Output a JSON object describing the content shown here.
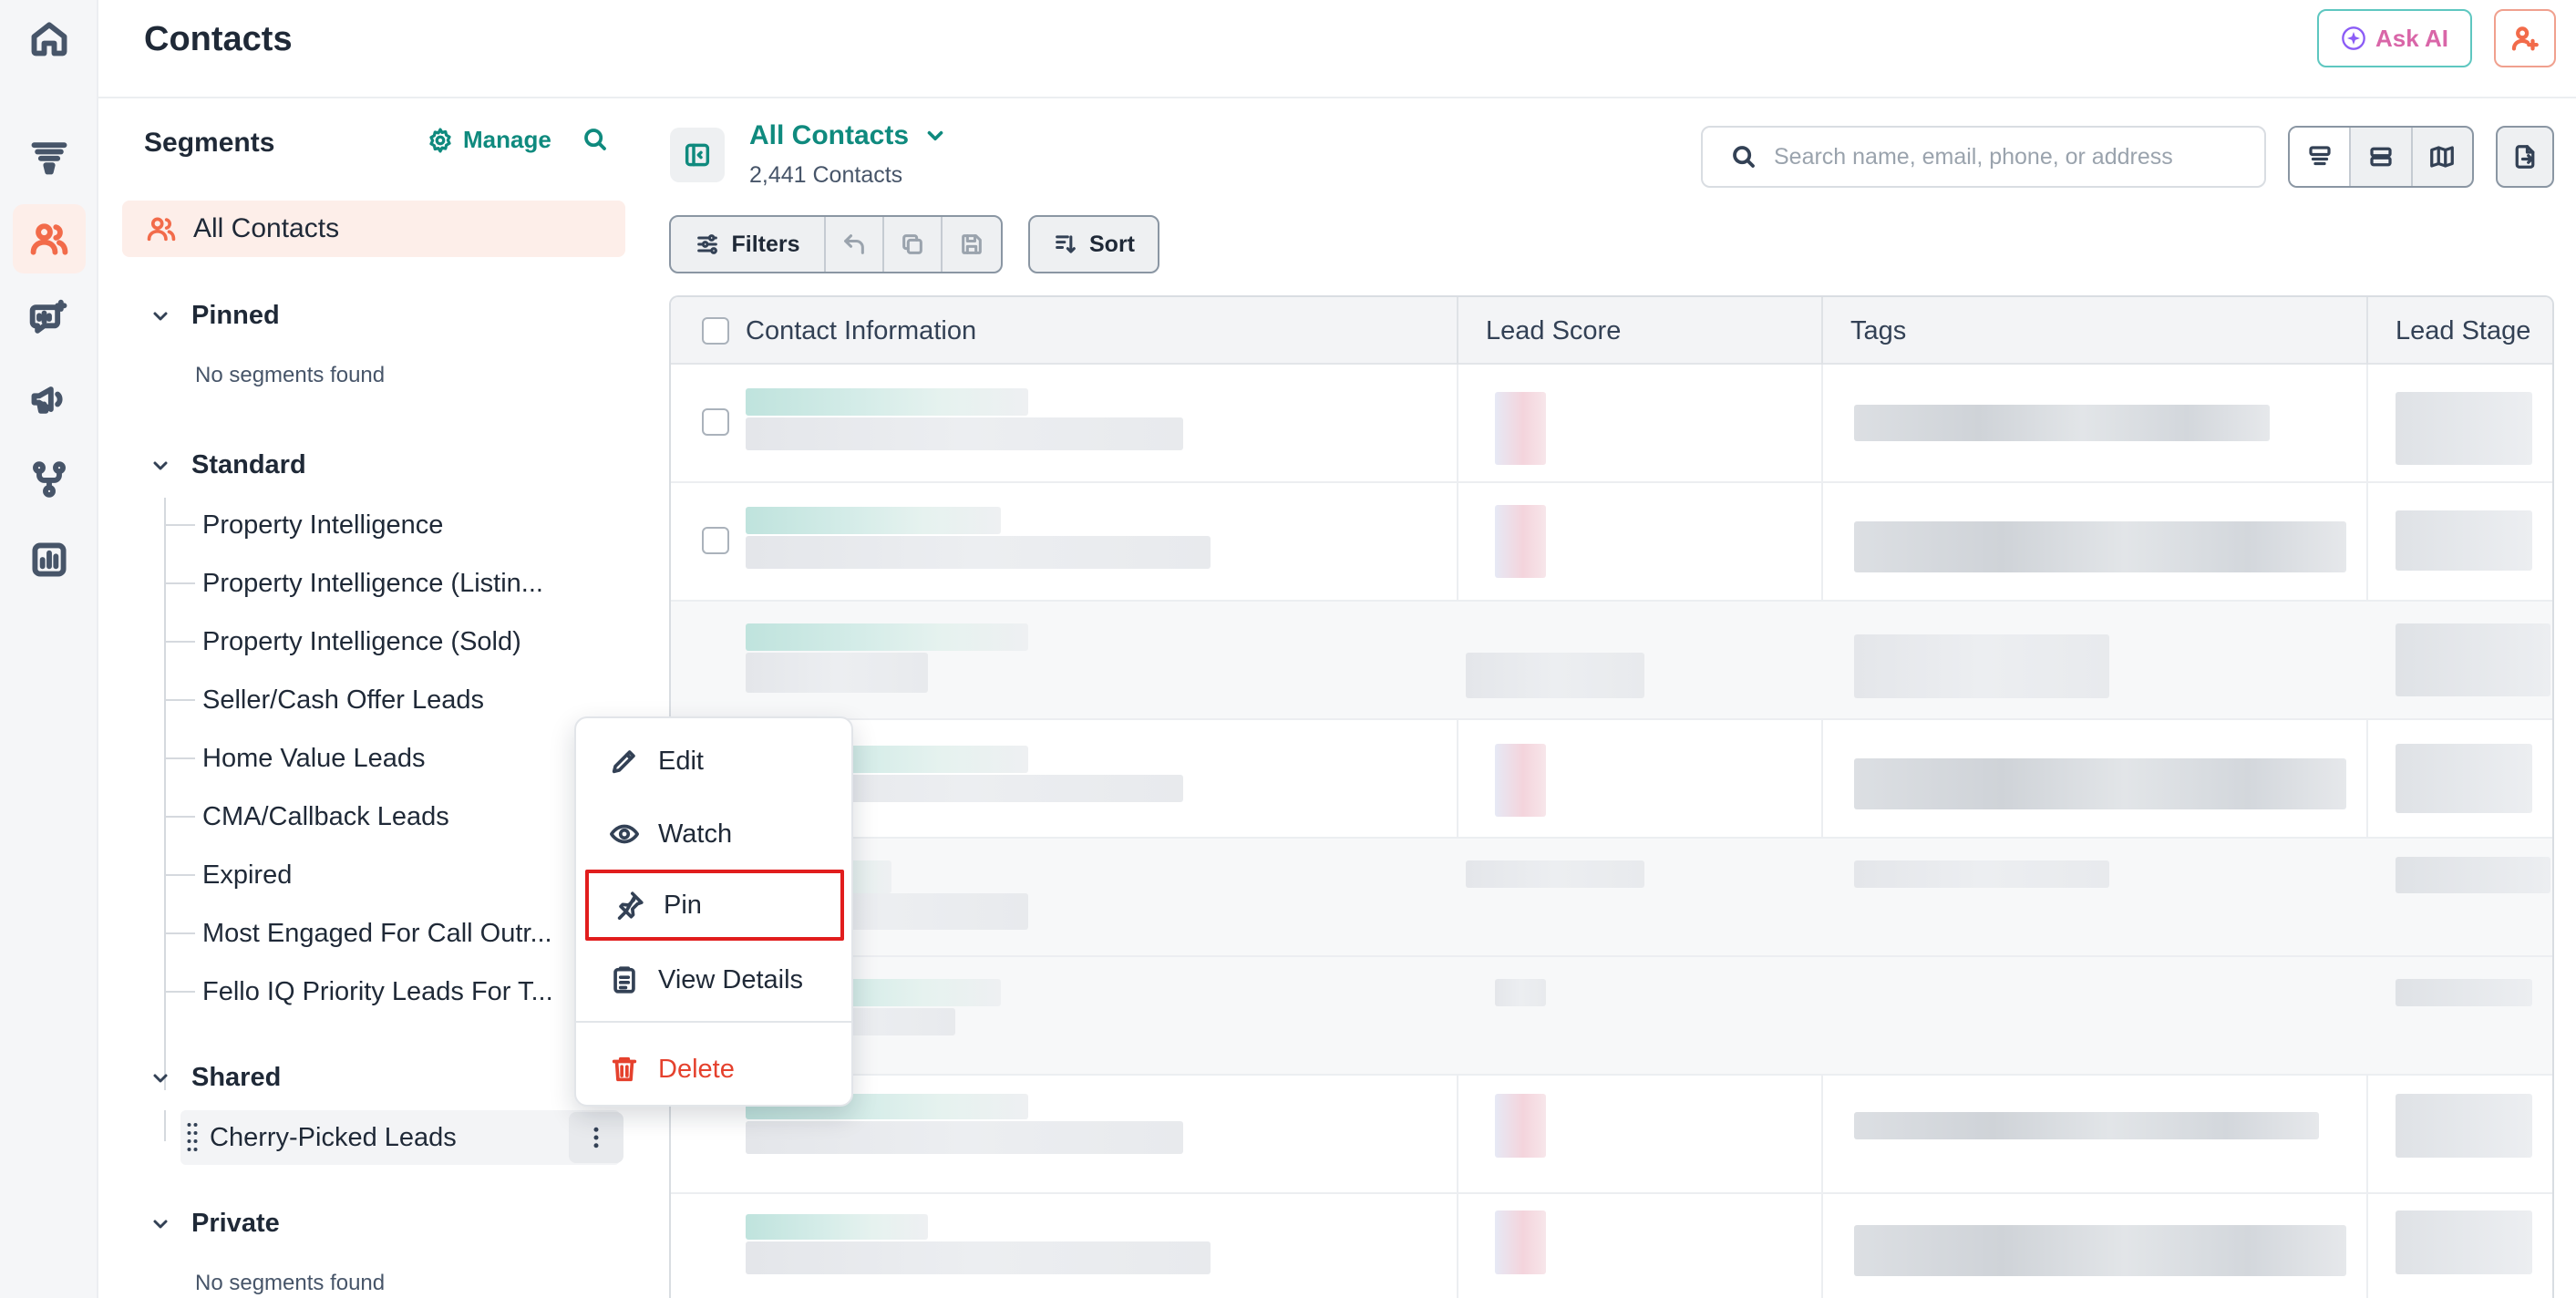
{
  "header": {
    "title": "Contacts",
    "ask_ai_label": "Ask AI"
  },
  "rail": {
    "items": [
      {
        "icon": "home-icon"
      },
      {
        "icon": "funnel-icon"
      },
      {
        "icon": "contacts-icon",
        "active": true
      },
      {
        "icon": "conversations-icon"
      },
      {
        "icon": "campaigns-icon"
      },
      {
        "icon": "workflows-icon"
      },
      {
        "icon": "reports-icon"
      }
    ]
  },
  "segments": {
    "title": "Segments",
    "manage_label": "Manage",
    "all_contacts": "All Contacts",
    "pinned": {
      "label": "Pinned",
      "empty": "No segments found"
    },
    "standard": {
      "label": "Standard",
      "items": [
        "Property Intelligence",
        "Property Intelligence (Listin...",
        "Property Intelligence (Sold)",
        "Seller/Cash Offer Leads",
        "Home Value Leads",
        "CMA/Callback Leads",
        "Expired",
        "Most Engaged For Call Outr...",
        "Fello IQ Priority Leads For T..."
      ]
    },
    "shared": {
      "label": "Shared",
      "items": [
        "Cherry-Picked Leads"
      ]
    },
    "private": {
      "label": "Private",
      "empty": "No segments found"
    }
  },
  "main": {
    "view_title": "All Contacts",
    "contact_count": "2,441 Contacts",
    "search_placeholder": "Search name, email, phone, or address",
    "filters_label": "Filters",
    "sort_label": "Sort"
  },
  "table": {
    "columns": [
      "Contact Information",
      "Lead Score",
      "Tags",
      "Lead Stage"
    ]
  },
  "context_menu": {
    "items": [
      {
        "label": "Edit",
        "icon": "pencil-icon"
      },
      {
        "label": "Watch",
        "icon": "eye-icon"
      },
      {
        "label": "Pin",
        "icon": "pin-icon",
        "highlighted": true
      },
      {
        "label": "View Details",
        "icon": "clipboard-icon"
      },
      {
        "label": "Delete",
        "icon": "trash-icon",
        "danger": true
      }
    ]
  },
  "colors": {
    "accent": "#0f8a7e",
    "brand_orange": "#f26b4a",
    "danger": "#e5412d",
    "highlight_border": "#e11d1d"
  }
}
